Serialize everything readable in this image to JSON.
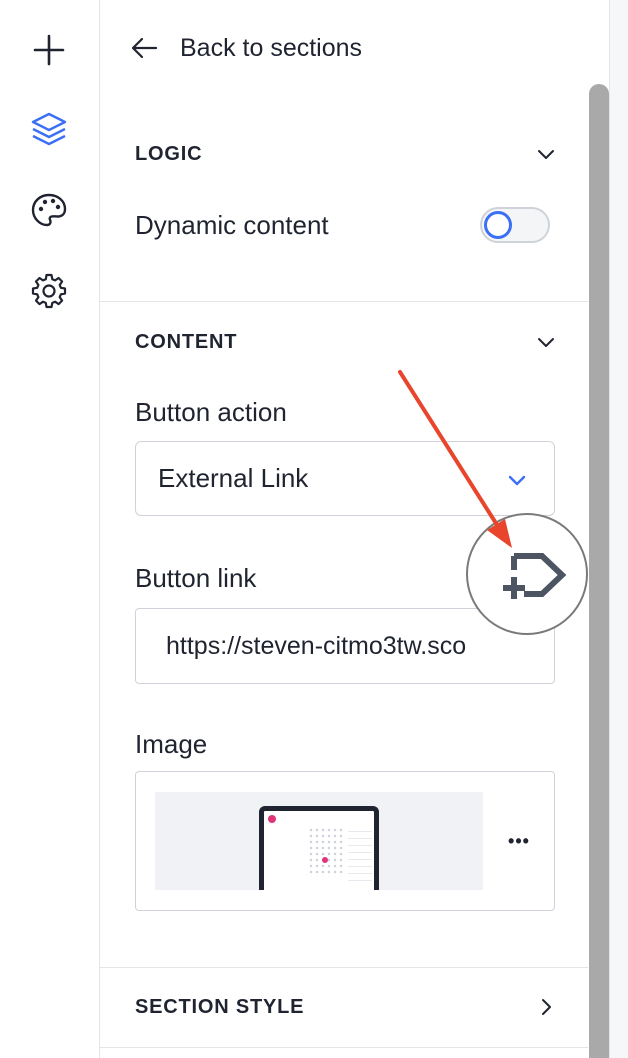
{
  "rail": {
    "items": [
      {
        "icon": "plus-icon",
        "active": false
      },
      {
        "icon": "layers-icon",
        "active": true
      },
      {
        "icon": "palette-icon",
        "active": false
      },
      {
        "icon": "gear-icon",
        "active": false
      }
    ],
    "active_color": "#3b6ff5"
  },
  "panel": {
    "back_label": "Back to sections",
    "logic": {
      "title": "LOGIC",
      "dynamic_content_label": "Dynamic content",
      "dynamic_content_on": false
    },
    "content": {
      "title": "CONTENT",
      "button_action_label": "Button action",
      "button_action_value": "External Link",
      "button_link_label": "Button link",
      "button_link_value": "https://steven-citmo3tw.sco",
      "image_label": "Image",
      "image_more": "•••"
    },
    "section_style": {
      "title": "SECTION STYLE"
    }
  },
  "annotation": {
    "arrow_color": "#e8452c",
    "cursor_icon": "add-label-cursor-icon"
  }
}
